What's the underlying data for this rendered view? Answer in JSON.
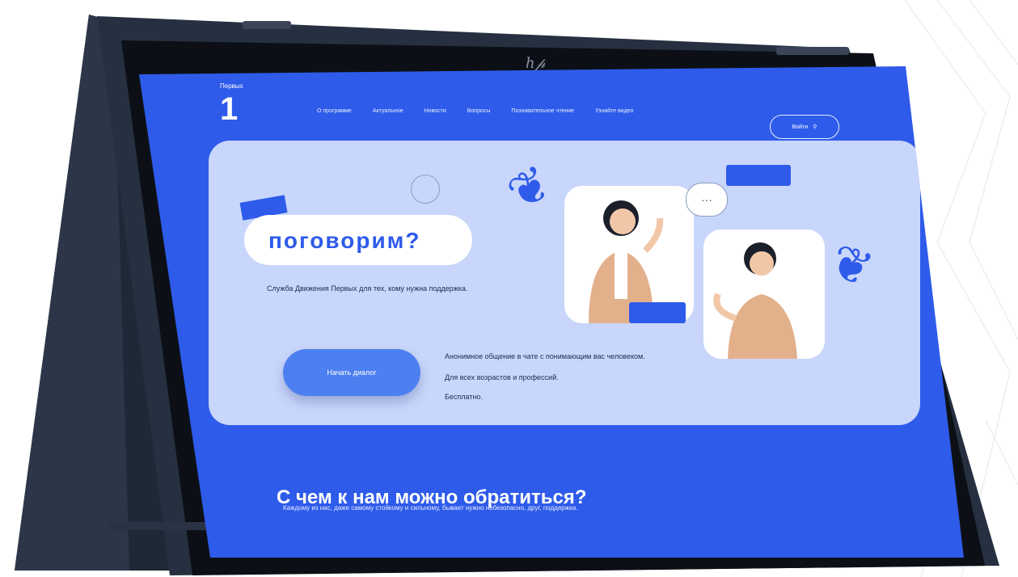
{
  "colors": {
    "brand_blue": "#2E5BEA",
    "hero_bg": "#C9D6FB",
    "laptop_body": "#263040",
    "bezel": "#0c1016"
  },
  "laptop": {
    "brand_logo_icon": "hp-logo-icon"
  },
  "site": {
    "logo_caption": "Первых",
    "nav": [
      "О программе",
      "Актуальное",
      "Новости",
      "Вопросы",
      "Познавательное чтение",
      "Узнайте видео"
    ],
    "search_label": "Войти",
    "hero": {
      "headline": "поговорим?",
      "description": "Служба Движения Первых для тех, кому нужна поддержка.",
      "button_label": "Начать диалог",
      "features": [
        "Анонимное общение в чате с понимающим вас человеком.",
        "Для всех возрастов и профессий.",
        "Бесплатно."
      ],
      "dots": "···"
    },
    "section": {
      "title": "С чем к нам можно обратиться?",
      "description": "Каждому из нас, даже самому стойкому и сильному, бывает нужно небезопасно, друг, поддержка."
    }
  }
}
